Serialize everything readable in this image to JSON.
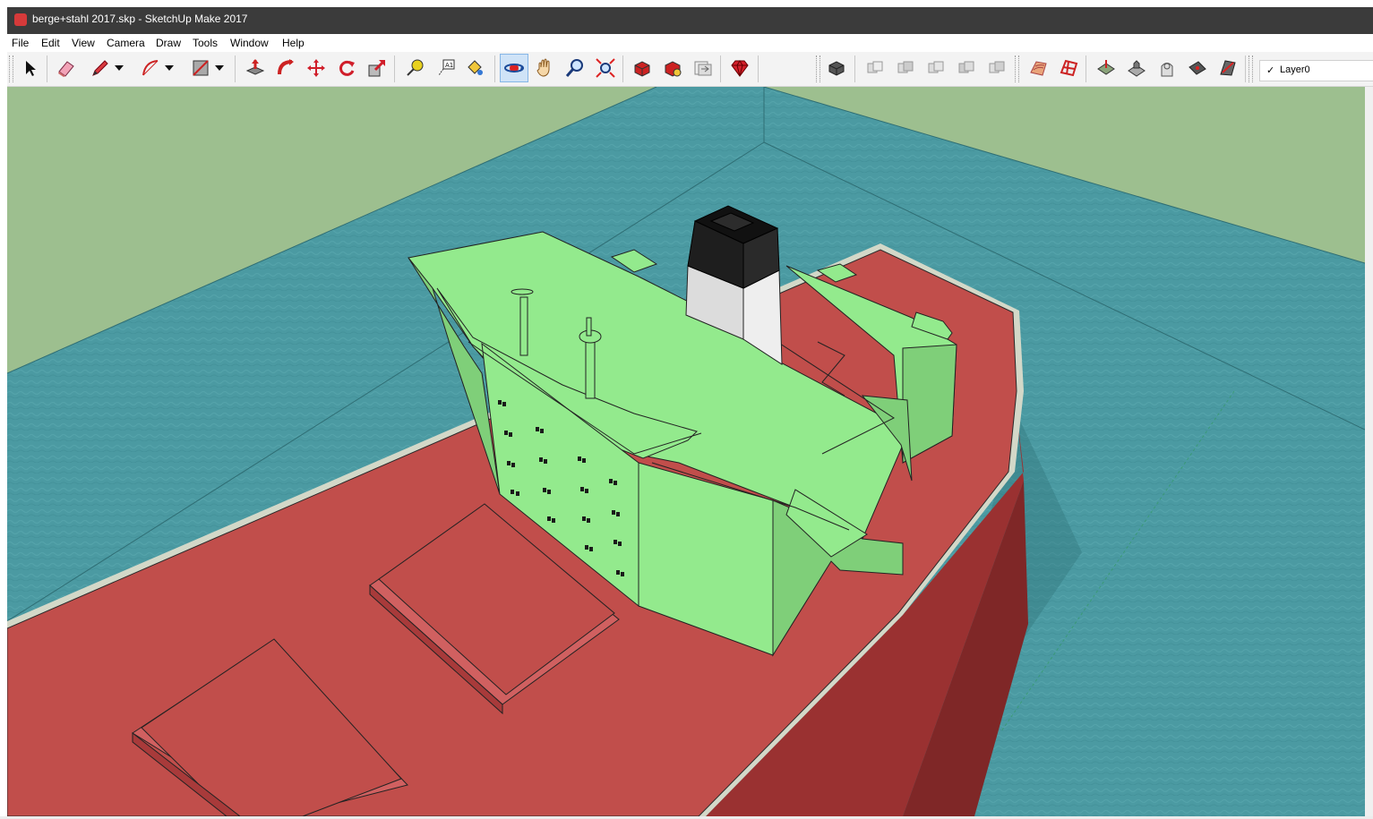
{
  "window": {
    "title": "berge+stahl 2017.skp - SketchUp Make 2017"
  },
  "menu": [
    "File",
    "Edit",
    "View",
    "Camera",
    "Draw",
    "Tools",
    "Window",
    "Help"
  ],
  "toolbar": {
    "tools": [
      "select-icon",
      "eraser-icon",
      "pencil-line-icon",
      "arc-icon",
      "rectangle-icon",
      "push-pull-icon",
      "follow-me-icon",
      "move-icon",
      "rotate-icon",
      "scale-icon",
      "tape-measure-icon",
      "text-icon",
      "paint-bucket-icon",
      "orbit-icon",
      "pan-icon",
      "zoom-icon",
      "zoom-extents-icon",
      "3d-warehouse-icon",
      "extension-warehouse-icon",
      "layout-icon",
      "extension-manager-icon",
      "component-icon",
      "outer-shell-icon",
      "intersect-icon",
      "union-icon",
      "subtract-icon",
      "trim-icon",
      "sandbox-contours-icon",
      "sandbox-scratch-icon",
      "smoove-icon",
      "stamp-icon",
      "drape-icon",
      "add-detail-icon",
      "flip-edge-icon"
    ],
    "active_tool": "orbit-icon"
  },
  "layer": {
    "current": "Layer0",
    "checked": true
  },
  "colors": {
    "sky": "#9dbf8f",
    "water": "#4b9aa2",
    "hull_deck": "#c14e4b",
    "hull_side": "#9a3131",
    "superstructure": "#93ea8d",
    "superstructure_shade": "#7fcf79",
    "funnel_top": "#1e1e1e",
    "funnel_body": "#dcdcdc"
  }
}
